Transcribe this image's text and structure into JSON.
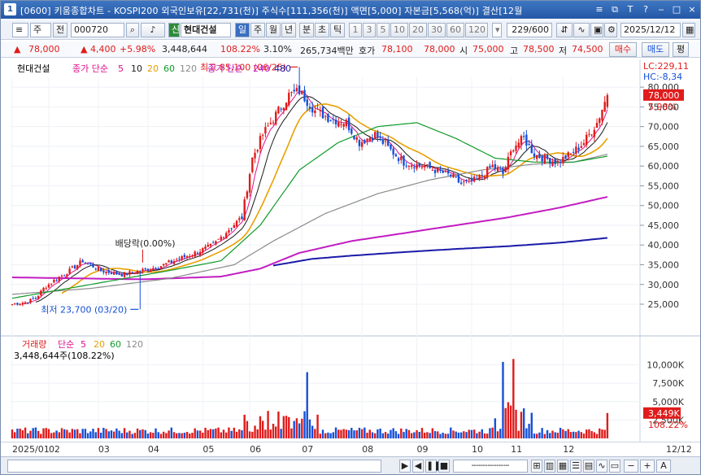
{
  "titlebar": {
    "icon": "1",
    "text": "[0600] 키움종합차트 - KOSPI200 외국인보유[22,731(천)] 주식수[111,356(천)] 액면[5,000] 자본금[5,568(억)] 결산[12월",
    "win_btns": [
      "≡",
      "⧉",
      "T",
      "?",
      "‒",
      "□",
      "×"
    ]
  },
  "toolbar": {
    "market": "주",
    "prev": "전",
    "code": "000720",
    "badge": "신",
    "name": "현대건설",
    "periods": [
      "일",
      "주",
      "월",
      "년",
      "분",
      "초",
      "틱"
    ],
    "intervals": [
      "1",
      "3",
      "5",
      "10",
      "20",
      "30",
      "60",
      "120"
    ],
    "count": "229/600",
    "date": "2025/12/12"
  },
  "quote": {
    "price": "78,000",
    "change": "4,400",
    "change_pct": "+5.98%",
    "volume": "3,448,644",
    "vol_ratio": "108.22%",
    "turnover_rate": "3.10%",
    "amount": "265,734백만",
    "bid_label": "호가",
    "bid": "78,100",
    "ask": "78,000",
    "open_label": "시",
    "open": "75,000",
    "high_label": "고",
    "high": "78,500",
    "low_label": "저",
    "low": "74,500",
    "buy": "매수",
    "sell": "매도",
    "eval": "평"
  },
  "price_panel": {
    "stock": "현대건설",
    "ma_label": "종가 단순",
    "ma_periods": [
      "5",
      "10",
      "20",
      "60",
      "120"
    ],
    "ma_label2": "종가 단순",
    "ma_periods2": [
      "240",
      "480"
    ],
    "lc": "LC:229,11",
    "hc": "HC:-8,34",
    "cur_price": "78,000",
    "cur_pct": "5.98%",
    "high_note": "최고 85,100 (06/25)",
    "low_note": "최저 23,700 (03/20)",
    "dividend_note": "배당락(0.00%)"
  },
  "vol_panel": {
    "label": "거래량",
    "ma_label": "단순",
    "ma_periods": [
      "5",
      "20",
      "60",
      "120"
    ],
    "summary": "3,448,644주(108.22%)",
    "cur": "3,449K",
    "cur_pct": "108.22%"
  },
  "colors": {
    "up": "#e01b1b",
    "down": "#1450d8",
    "ma5": "#e0108c",
    "ma10": "#1a1a1a",
    "ma20": "#e8a000",
    "ma60": "#0f9a2a",
    "ma120": "#8a8a8a",
    "ma240": "#c21cc2",
    "ma480": "#1a1aa8"
  },
  "status": {
    "zoom_minus": "−",
    "zoom_plus": "+",
    "auto": "A"
  },
  "chart_data": {
    "type": "candlestick",
    "price_axis": {
      "ticks": [
        80000,
        75000,
        70000,
        65000,
        60000,
        55000,
        50000,
        45000,
        40000,
        35000,
        30000,
        25000
      ],
      "ylim": [
        21500,
        82500
      ]
    },
    "volume_axis": {
      "ticks": [
        "10,000K",
        "7,500K",
        "5,000K",
        "2,500K"
      ],
      "values": [
        10000,
        7500,
        5000,
        2500
      ],
      "ylim": [
        0,
        11500
      ]
    },
    "months": [
      {
        "label": "2025/01",
        "idx": 0
      },
      {
        "label": "02",
        "idx": 14
      },
      {
        "label": "03",
        "idx": 33
      },
      {
        "label": "04",
        "idx": 52
      },
      {
        "label": "05",
        "idx": 73
      },
      {
        "label": "06",
        "idx": 91
      },
      {
        "label": "07",
        "idx": 111
      },
      {
        "label": "08",
        "idx": 134
      },
      {
        "label": "09",
        "idx": 155
      },
      {
        "label": "10",
        "idx": 176
      },
      {
        "label": "11",
        "idx": 191
      },
      {
        "label": "12",
        "idx": 211
      },
      {
        "label": "12/12",
        "idx": 240
      }
    ],
    "anchors": [
      [
        0,
        25000
      ],
      [
        5,
        25500
      ],
      [
        9,
        26500
      ],
      [
        12,
        29000
      ],
      [
        16,
        31000
      ],
      [
        22,
        33500
      ],
      [
        27,
        36000
      ],
      [
        34,
        33500
      ],
      [
        42,
        32500
      ],
      [
        49,
        33500
      ],
      [
        56,
        34500
      ],
      [
        62,
        36000
      ],
      [
        70,
        38000
      ],
      [
        77,
        40000
      ],
      [
        83,
        44000
      ],
      [
        88,
        47000
      ],
      [
        92,
        62000
      ],
      [
        96,
        68000
      ],
      [
        101,
        73000
      ],
      [
        106,
        78000
      ],
      [
        110,
        79000
      ],
      [
        116,
        74000
      ],
      [
        122,
        72000
      ],
      [
        128,
        71000
      ],
      [
        133,
        66000
      ],
      [
        139,
        68000
      ],
      [
        145,
        64000
      ],
      [
        150,
        61000
      ],
      [
        157,
        60000
      ],
      [
        162,
        59000
      ],
      [
        168,
        57500
      ],
      [
        172,
        55500
      ],
      [
        178,
        56500
      ],
      [
        184,
        60000
      ],
      [
        188,
        58000
      ],
      [
        192,
        65000
      ],
      [
        196,
        67000
      ],
      [
        200,
        63000
      ],
      [
        204,
        62000
      ],
      [
        209,
        61000
      ],
      [
        214,
        63000
      ],
      [
        219,
        66000
      ],
      [
        224,
        71000
      ],
      [
        228,
        78000
      ]
    ],
    "ma_anchors": {
      "ma240": [
        [
          0,
          31800
        ],
        [
          30,
          31500
        ],
        [
          50,
          31300
        ],
        [
          80,
          32000
        ],
        [
          95,
          34000
        ],
        [
          110,
          38000
        ],
        [
          130,
          41000
        ],
        [
          150,
          43000
        ],
        [
          170,
          45000
        ],
        [
          190,
          47000
        ],
        [
          210,
          49500
        ],
        [
          228,
          52200
        ]
      ],
      "ma480": [
        [
          100,
          34800
        ],
        [
          115,
          36500
        ],
        [
          130,
          37300
        ],
        [
          150,
          38200
        ],
        [
          170,
          39000
        ],
        [
          190,
          39700
        ],
        [
          210,
          40600
        ],
        [
          228,
          41800
        ]
      ],
      "ma120": [
        [
          0,
          27500
        ],
        [
          30,
          29000
        ],
        [
          60,
          31500
        ],
        [
          85,
          35000
        ],
        [
          100,
          41000
        ],
        [
          120,
          48000
        ],
        [
          140,
          53000
        ],
        [
          160,
          56500
        ],
        [
          180,
          59000
        ],
        [
          200,
          60500
        ],
        [
          215,
          61000
        ],
        [
          228,
          63000
        ]
      ],
      "ma60": [
        [
          0,
          26500
        ],
        [
          30,
          30000
        ],
        [
          60,
          33500
        ],
        [
          80,
          36000
        ],
        [
          95,
          45000
        ],
        [
          110,
          59000
        ],
        [
          125,
          66000
        ],
        [
          140,
          70000
        ],
        [
          155,
          71000
        ],
        [
          170,
          67000
        ],
        [
          185,
          62000
        ],
        [
          200,
          61000
        ],
        [
          215,
          61000
        ],
        [
          228,
          62500
        ]
      ]
    },
    "high": {
      "idx": 110,
      "value": 85100,
      "date": "06/25"
    },
    "low": {
      "idx": 49,
      "value": 23700,
      "date": "03/20"
    },
    "dividend": {
      "idx": 50,
      "label": "배당락(0.00%)"
    },
    "last": {
      "open": 75000,
      "high": 78500,
      "low": 74500,
      "close": 78000,
      "volume": 3449
    }
  }
}
